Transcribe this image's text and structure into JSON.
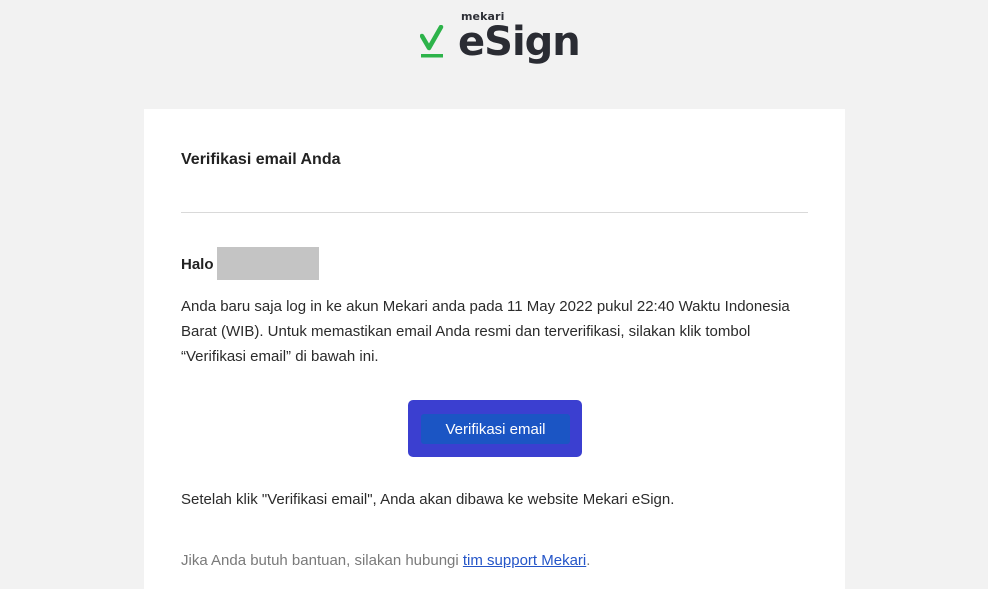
{
  "header": {
    "brand_small": "mekari",
    "brand_main": "eSign",
    "brand_color": "#2db34a"
  },
  "email": {
    "title": "Verifikasi email Anda",
    "greeting": "Halo",
    "body": "Anda baru saja log in ke akun Mekari anda pada 11 May 2022 pukul 22:40 Waktu Indonesia Barat (WIB). Untuk memastikan email Anda resmi dan terverifikasi, silakan klik tombol “Verifikasi email” di bawah ini.",
    "button_label": "Verifikasi email",
    "button_color": "#1b55c4",
    "highlight_color": "#3b3fd0",
    "after_text": "Setelah klik \"Verifikasi email\", Anda akan dibawa ke website Mekari eSign.",
    "help_prefix": "Jika Anda butuh bantuan, silakan hubungi ",
    "help_link": "tim support Mekari",
    "help_suffix": "."
  }
}
